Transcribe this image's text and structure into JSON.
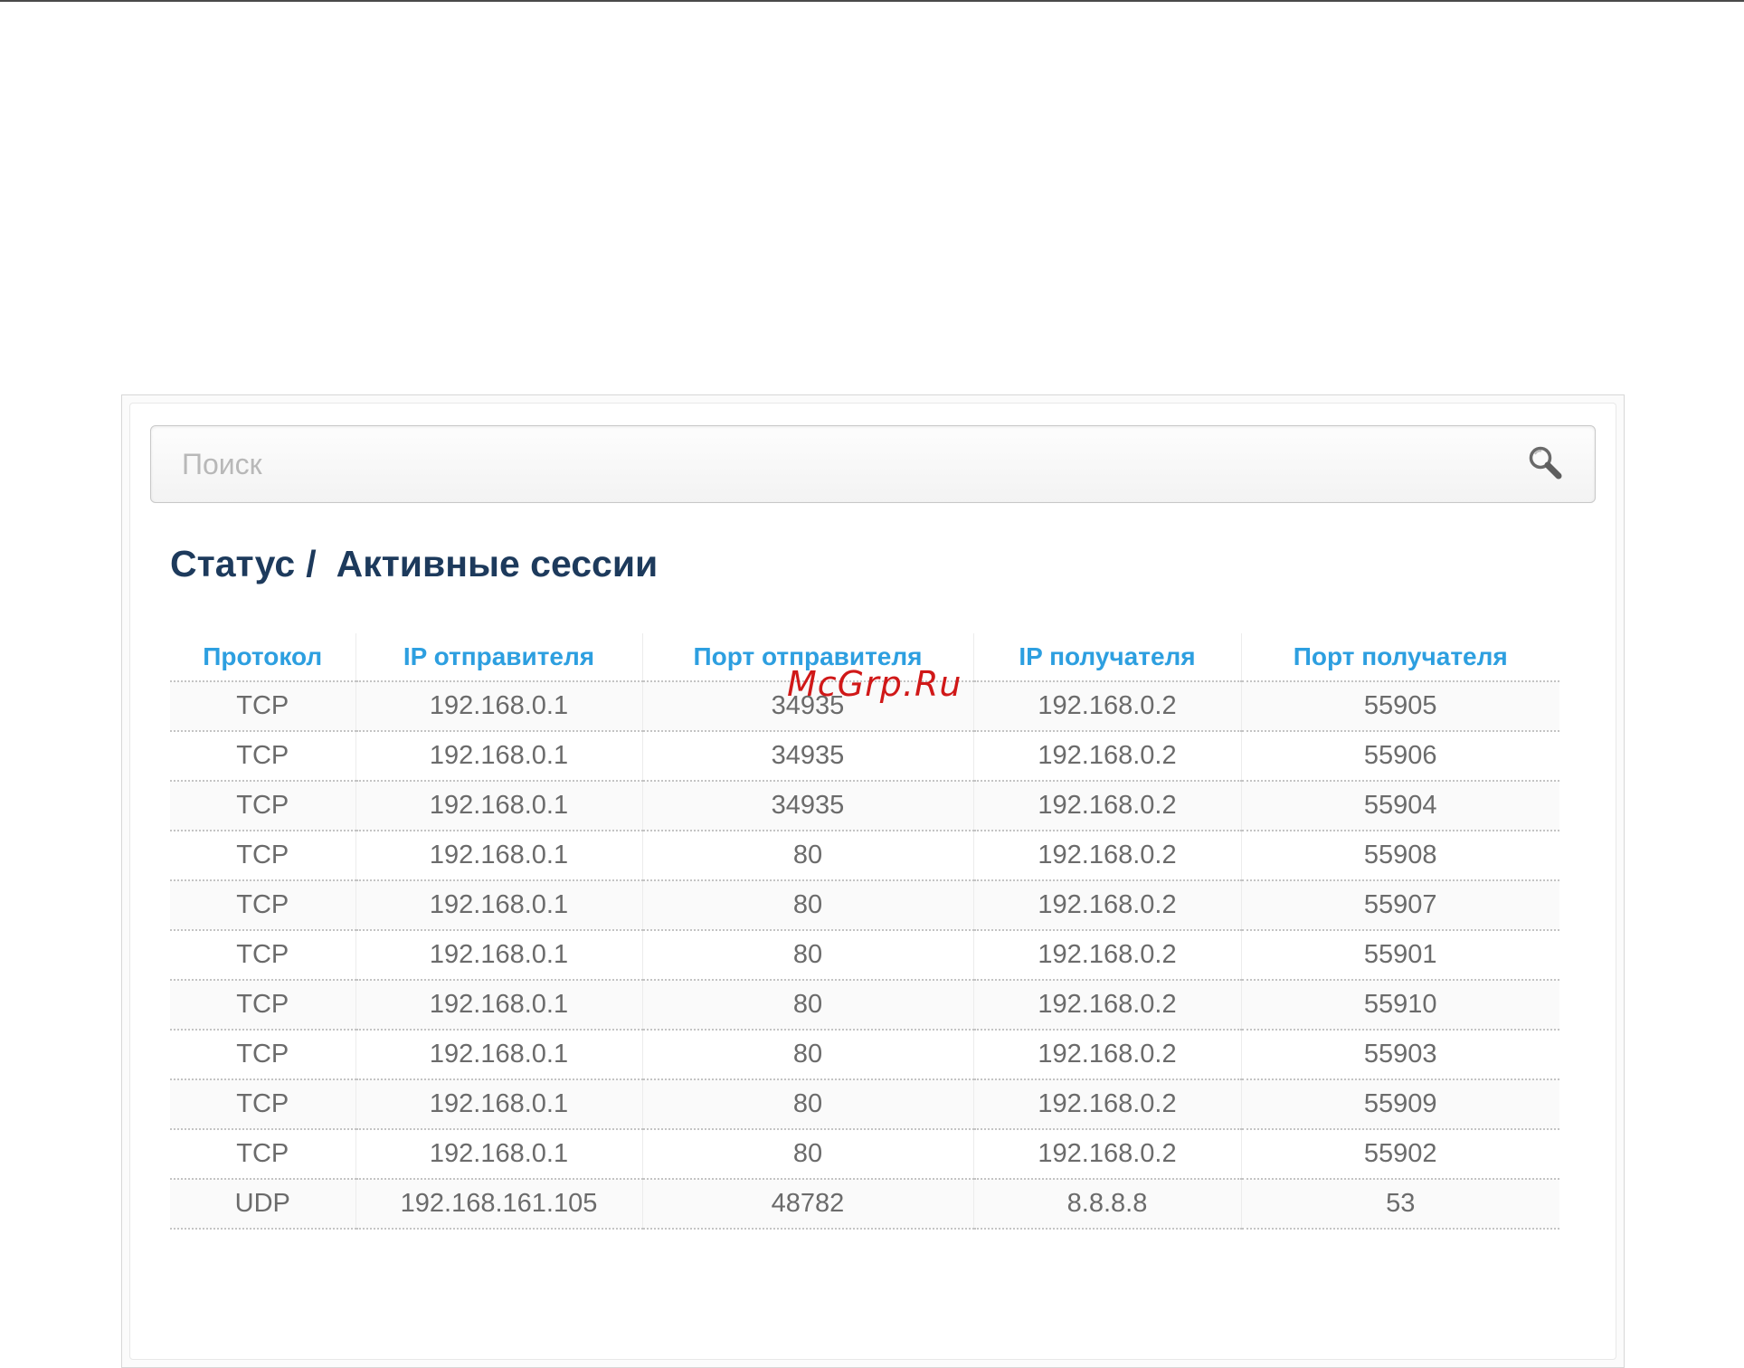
{
  "search": {
    "placeholder": "Поиск",
    "value": ""
  },
  "breadcrumb": {
    "parent": "Статус",
    "separator": "/",
    "current": "Активные сессии"
  },
  "table": {
    "headers": [
      "Протокол",
      "IP отправителя",
      "Порт отправителя",
      "IP получателя",
      "Порт получателя"
    ],
    "rows": [
      [
        "TCP",
        "192.168.0.1",
        "34935",
        "192.168.0.2",
        "55905"
      ],
      [
        "TCP",
        "192.168.0.1",
        "34935",
        "192.168.0.2",
        "55906"
      ],
      [
        "TCP",
        "192.168.0.1",
        "34935",
        "192.168.0.2",
        "55904"
      ],
      [
        "TCP",
        "192.168.0.1",
        "80",
        "192.168.0.2",
        "55908"
      ],
      [
        "TCP",
        "192.168.0.1",
        "80",
        "192.168.0.2",
        "55907"
      ],
      [
        "TCP",
        "192.168.0.1",
        "80",
        "192.168.0.2",
        "55901"
      ],
      [
        "TCP",
        "192.168.0.1",
        "80",
        "192.168.0.2",
        "55910"
      ],
      [
        "TCP",
        "192.168.0.1",
        "80",
        "192.168.0.2",
        "55903"
      ],
      [
        "TCP",
        "192.168.0.1",
        "80",
        "192.168.0.2",
        "55909"
      ],
      [
        "TCP",
        "192.168.0.1",
        "80",
        "192.168.0.2",
        "55902"
      ],
      [
        "UDP",
        "192.168.161.105",
        "48782",
        "8.8.8.8",
        "53"
      ]
    ]
  },
  "watermark": "McGrp.Ru",
  "colors": {
    "header_text": "#2d9fe0",
    "title_text": "#1d3a5c",
    "cell_text": "#6b6b6b",
    "watermark": "#d01818"
  },
  "icons": {
    "search": "search-icon"
  }
}
